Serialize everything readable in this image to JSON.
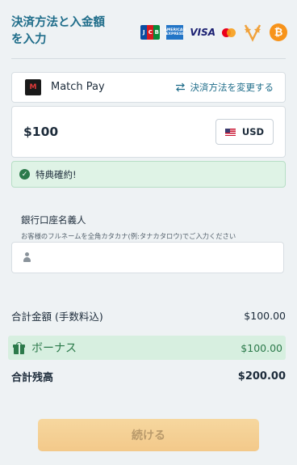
{
  "header": {
    "title": "決済方法と入金額を入力"
  },
  "payment_icons": {
    "jcb": [
      "J",
      "C",
      "B"
    ],
    "amex": "AMERICAN EXPRESS",
    "visa": "VISA",
    "bitcoin": "₿"
  },
  "method": {
    "name": "Match Pay",
    "logo_text": "M",
    "change_label": "決済方法を変更する"
  },
  "amount": {
    "value": "$100",
    "currency": "USD"
  },
  "bonus_banner": {
    "text": "特典確約!"
  },
  "account_name": {
    "label": "銀行口座名義人",
    "hint": "お客様のフルネームを全角カタカナ(例:タナカタロウ)でご入力ください",
    "value": ""
  },
  "summary": {
    "total_amount_label": "合計金額 (手数料込)",
    "total_amount_value": "$100.00",
    "bonus_label": "ボーナス",
    "bonus_value": "$100.00",
    "total_balance_label": "合計残高",
    "total_balance_value": "$200.00"
  },
  "continue_label": "続ける",
  "colors": {
    "accent": "#1f6d8a",
    "success": "#2c7a4b",
    "button": "#f3c98a"
  }
}
